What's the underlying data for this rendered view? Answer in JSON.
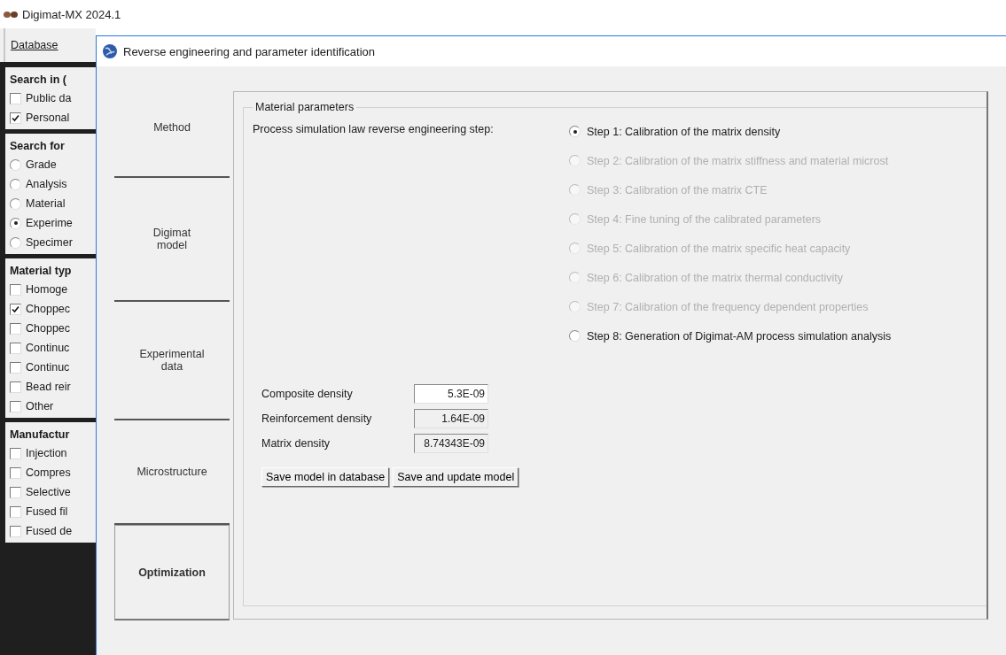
{
  "app": {
    "title": "Digimat-MX 2024.1"
  },
  "menu": [
    {
      "label": "Database"
    }
  ],
  "sidebar": {
    "sections": [
      {
        "title": "Search in (",
        "items": [
          {
            "kind": "checkbox",
            "label": "Public da",
            "checked": false
          },
          {
            "kind": "checkbox",
            "label": "Personal",
            "checked": true
          }
        ]
      },
      {
        "title": "Search for",
        "items": [
          {
            "kind": "radio",
            "label": "Grade",
            "selected": false
          },
          {
            "kind": "radio",
            "label": "Analysis",
            "selected": false
          },
          {
            "kind": "radio",
            "label": "Material",
            "selected": false
          },
          {
            "kind": "radio",
            "label": "Experime",
            "selected": true
          },
          {
            "kind": "radio",
            "label": "Specimer",
            "selected": false
          }
        ]
      },
      {
        "title": "Material typ",
        "items": [
          {
            "kind": "checkbox",
            "label": "Homoge",
            "checked": false
          },
          {
            "kind": "checkbox",
            "label": "Choppec",
            "checked": true
          },
          {
            "kind": "checkbox",
            "label": "Choppec",
            "checked": false
          },
          {
            "kind": "checkbox",
            "label": "Continuc",
            "checked": false
          },
          {
            "kind": "checkbox",
            "label": "Continuc",
            "checked": false
          },
          {
            "kind": "checkbox",
            "label": "Bead reir",
            "checked": false
          },
          {
            "kind": "checkbox",
            "label": "Other",
            "checked": false
          }
        ]
      },
      {
        "title": "Manufactur",
        "items": [
          {
            "kind": "checkbox",
            "label": "Injection",
            "checked": false
          },
          {
            "kind": "checkbox",
            "label": "Compres",
            "checked": false
          },
          {
            "kind": "checkbox",
            "label": "Selective",
            "checked": false
          },
          {
            "kind": "checkbox",
            "label": "Fused fil",
            "checked": false
          },
          {
            "kind": "checkbox",
            "label": "Fused de",
            "checked": false
          }
        ]
      }
    ]
  },
  "dialog": {
    "title": "Reverse engineering and parameter identification",
    "nav": [
      {
        "label": "Method",
        "selected": false
      },
      {
        "label": "Digimat\nmodel",
        "selected": false
      },
      {
        "label": "Experimental\ndata",
        "selected": false
      },
      {
        "label": "Microstructure",
        "selected": false
      },
      {
        "label": "Optimization",
        "selected": true
      }
    ],
    "group": {
      "title": "Material parameters",
      "step_label": "Process simulation law reverse engineering step:",
      "steps": [
        {
          "label": "Step 1: Calibration of the matrix density",
          "selected": true,
          "disabled": false
        },
        {
          "label": "Step 2: Calibration of the matrix stiffness and material microst",
          "selected": false,
          "disabled": true
        },
        {
          "label": "Step 3: Calibration of the matrix CTE",
          "selected": false,
          "disabled": true
        },
        {
          "label": "Step 4: Fine tuning of the calibrated parameters",
          "selected": false,
          "disabled": true
        },
        {
          "label": "Step 5: Calibration of the matrix specific heat capacity",
          "selected": false,
          "disabled": true
        },
        {
          "label": "Step 6: Calibration of the matrix thermal conductivity",
          "selected": false,
          "disabled": true
        },
        {
          "label": "Step 7: Calibration of the frequency dependent properties",
          "selected": false,
          "disabled": true
        },
        {
          "label": "Step 8: Generation of Digimat-AM process simulation analysis",
          "selected": false,
          "disabled": false
        }
      ],
      "fields": [
        {
          "label": "Composite density",
          "value": "5.3E-09",
          "readonly": false
        },
        {
          "label": "Reinforcement density",
          "value": "1.64E-09",
          "readonly": true
        },
        {
          "label": "Matrix density",
          "value": "8.74343E-09",
          "readonly": true
        }
      ],
      "buttons": [
        {
          "label": "Save model in database"
        },
        {
          "label": "Save and update model"
        }
      ]
    }
  }
}
